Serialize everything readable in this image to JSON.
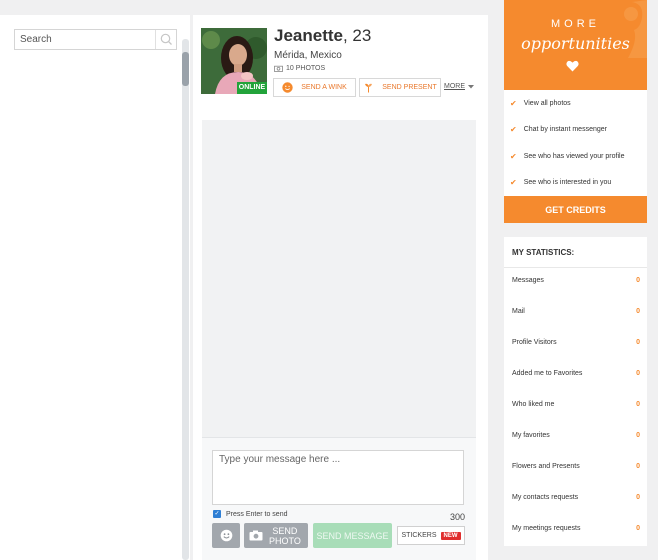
{
  "search": {
    "placeholder": "Search"
  },
  "profile": {
    "name": "Jeanette",
    "age": ", 23",
    "location": "Mérida, Mexico",
    "photos": "10 PHOTOS",
    "online_label": "ONLINE",
    "wink_label": "SEND A WINK",
    "present_label": "SEND PRESENT",
    "more_label": "MORE"
  },
  "composer": {
    "placeholder": "Type your message here ...",
    "enter_label": "Press Enter to send",
    "char_count": "300",
    "photo_label_1": "SEND",
    "photo_label_2": "PHOTO",
    "send_label": "SEND MESSAGE",
    "stickers_label": "STICKERS",
    "new_badge": "NEW"
  },
  "promo": {
    "more": "MORE",
    "opportunities": "opportunities",
    "benefits": [
      "View all photos",
      "Chat by instant messenger",
      "See who has viewed your profile",
      "See who is interested in you"
    ],
    "cta": "GET CREDITS"
  },
  "stats": {
    "title": "MY STATISTICS:",
    "rows": [
      {
        "label": "Messages",
        "value": "0"
      },
      {
        "label": "Mail",
        "value": "0"
      },
      {
        "label": "Profile Visitors",
        "value": "0"
      },
      {
        "label": "Added me to Favorites",
        "value": "0"
      },
      {
        "label": "Who liked me",
        "value": "0"
      },
      {
        "label": "My favorites",
        "value": "0"
      },
      {
        "label": "Flowers and Presents",
        "value": "0"
      },
      {
        "label": "My contacts requests",
        "value": "0"
      },
      {
        "label": "My meetings requests",
        "value": "0"
      }
    ]
  },
  "colors": {
    "accent": "#f58a2e",
    "online": "#22a33a",
    "send": "#a8ddb8"
  }
}
